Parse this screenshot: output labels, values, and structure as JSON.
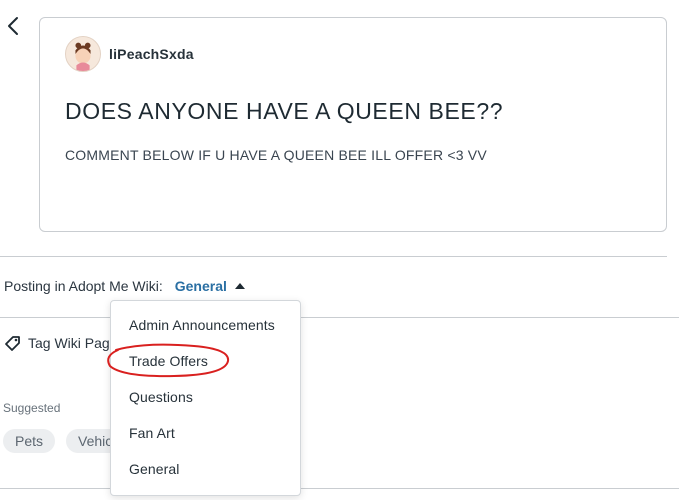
{
  "post": {
    "author": "liPeachSxda",
    "title": "DOES ANYONE HAVE A QUEEN BEE??",
    "body": "COMMENT BELOW IF U HAVE A QUEEN BEE ILL OFFER <3 VV"
  },
  "posting": {
    "label": "Posting in Adopt Me Wiki:",
    "category": "General"
  },
  "tag": {
    "label": "Tag Wiki Pages"
  },
  "suggested": {
    "label": "Suggested",
    "chips": [
      "Pets",
      "Vehicles"
    ]
  },
  "dropdown": {
    "items": [
      "Admin Announcements",
      "Trade Offers",
      "Questions",
      "Fan Art",
      "General"
    ]
  },
  "colors": {
    "accent": "#2a6fa3",
    "annotation": "#d9201f",
    "border": "#c9cdd1"
  },
  "icons": {
    "back": "chevron-left-icon",
    "caret": "caret-up-icon",
    "tag": "tag-icon"
  }
}
